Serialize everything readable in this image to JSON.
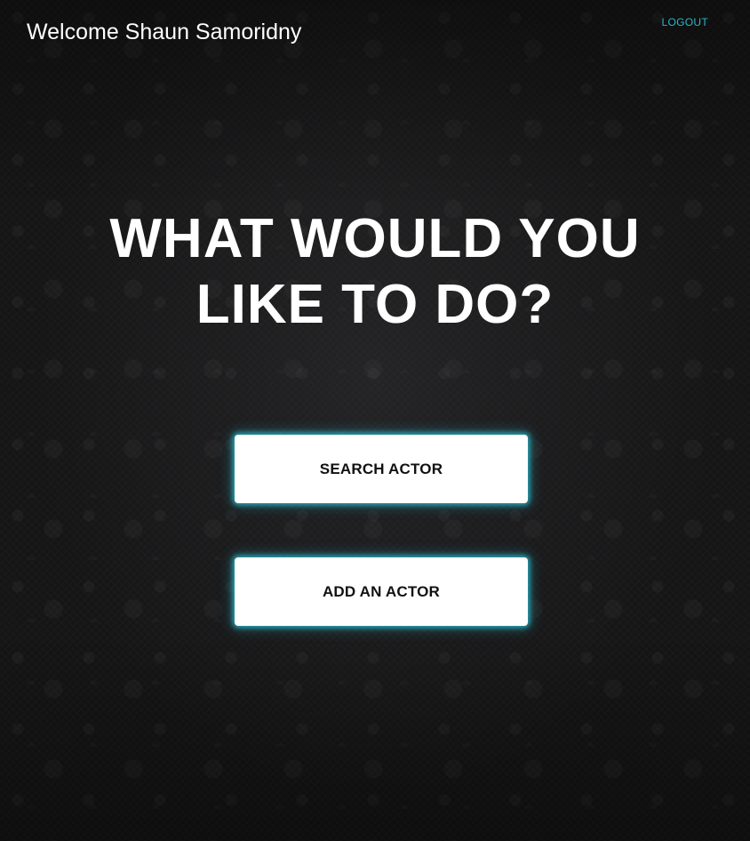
{
  "header": {
    "welcome_text": "Welcome Shaun Samoridny",
    "logout_label": "LOGOUT"
  },
  "main": {
    "headline_line1": "WHAT WOULD YOU",
    "headline_line2": "LIKE TO DO?",
    "actions": [
      {
        "label": "SEARCH ACTOR"
      },
      {
        "label": "ADD AN ACTOR"
      }
    ]
  },
  "colors": {
    "accent": "#2bb6c8",
    "glow": "#2ccce0",
    "background": "#151516",
    "button_bg": "#ffffff",
    "button_text": "#111111"
  }
}
